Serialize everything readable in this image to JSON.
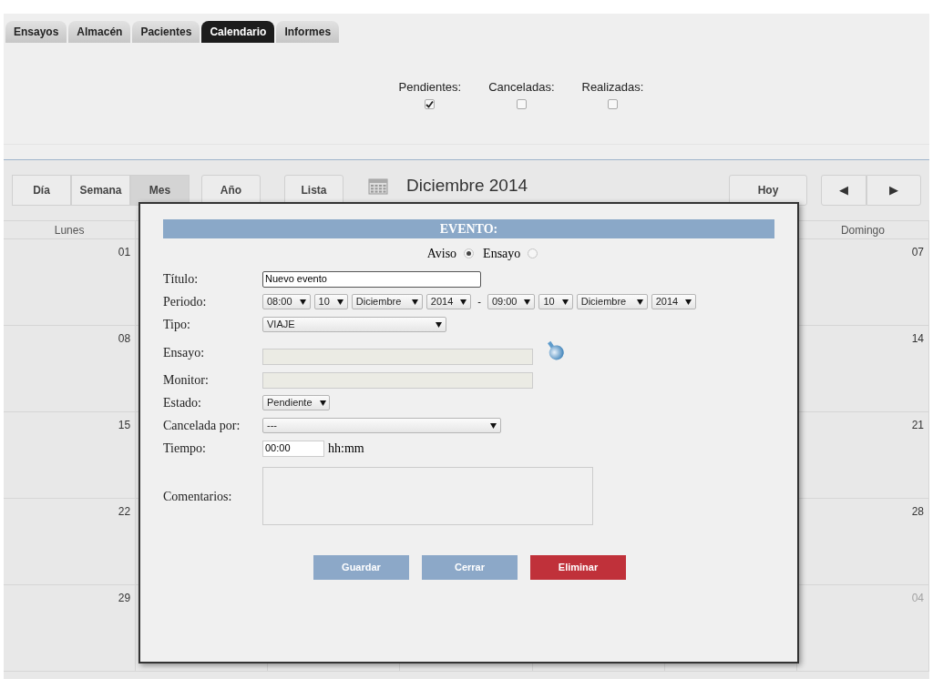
{
  "tabs": [
    {
      "label": "Ensayos",
      "selected": false
    },
    {
      "label": "Almacén",
      "selected": false
    },
    {
      "label": "Pacientes",
      "selected": false
    },
    {
      "label": "Calendario",
      "selected": true
    },
    {
      "label": "Informes",
      "selected": false
    }
  ],
  "filters": [
    {
      "label": "Pendientes:",
      "checked": true
    },
    {
      "label": "Canceladas:",
      "checked": false
    },
    {
      "label": "Realizadas:",
      "checked": false
    }
  ],
  "calendar": {
    "views": [
      {
        "label": "Día",
        "selected": false
      },
      {
        "label": "Semana",
        "selected": false
      },
      {
        "label": "Mes",
        "selected": true
      },
      {
        "label": "Año",
        "selected": false
      },
      {
        "label": "Lista",
        "selected": false
      }
    ],
    "title": "Diciembre 2014",
    "today": "Hoy",
    "prev": "◀",
    "next": "▶",
    "columns": [
      {
        "label": "Lunes"
      },
      {
        "label": "Domingo"
      }
    ],
    "weeks": [
      {
        "cells": [
          {
            "day": "01",
            "other_month": false
          },
          {
            "day": "07",
            "other_month": false
          }
        ]
      },
      {
        "cells": [
          {
            "day": "08",
            "other_month": false
          },
          {
            "day": "14",
            "other_month": false
          }
        ]
      },
      {
        "cells": [
          {
            "day": "15",
            "other_month": false
          },
          {
            "day": "21",
            "other_month": false
          }
        ]
      },
      {
        "cells": [
          {
            "day": "22",
            "other_month": false
          },
          {
            "day": "28",
            "other_month": false
          }
        ]
      },
      {
        "cells": [
          {
            "day": "29",
            "other_month": false
          },
          {
            "day": "04",
            "other_month": true
          }
        ]
      }
    ]
  },
  "dialog": {
    "title": "EVENTO:",
    "event_types": [
      {
        "label": "Aviso",
        "selected": true
      },
      {
        "label": "Ensayo",
        "selected": false
      }
    ],
    "fields": [
      {
        "kind": "text",
        "label": "Título:",
        "value": "Nuevo evento"
      },
      {
        "kind": "period",
        "label": "Periodo:",
        "start": [
          "08:00",
          "10",
          "Diciembre",
          "2014"
        ],
        "separator": "-",
        "end": [
          "09:00",
          "10",
          "Diciembre",
          "2014"
        ]
      },
      {
        "kind": "select",
        "label": "Tipo:",
        "value": "VIAJE"
      },
      {
        "kind": "lookup",
        "label": "Ensayo:"
      },
      {
        "kind": "readonly",
        "label": "Monitor:"
      },
      {
        "kind": "select",
        "label": "Estado:",
        "value": "Pendiente"
      },
      {
        "kind": "select",
        "label": "Cancelada por:",
        "value": "---"
      },
      {
        "kind": "time",
        "label": "Tiempo:",
        "value": "00:00",
        "unit": "hh:mm"
      },
      {
        "kind": "textarea",
        "label": "Comentarios:"
      }
    ],
    "buttons": [
      {
        "label": "Guardar",
        "kind": "primary"
      },
      {
        "label": "Cerrar",
        "kind": "primary"
      },
      {
        "label": "Eliminar",
        "kind": "danger"
      }
    ]
  }
}
